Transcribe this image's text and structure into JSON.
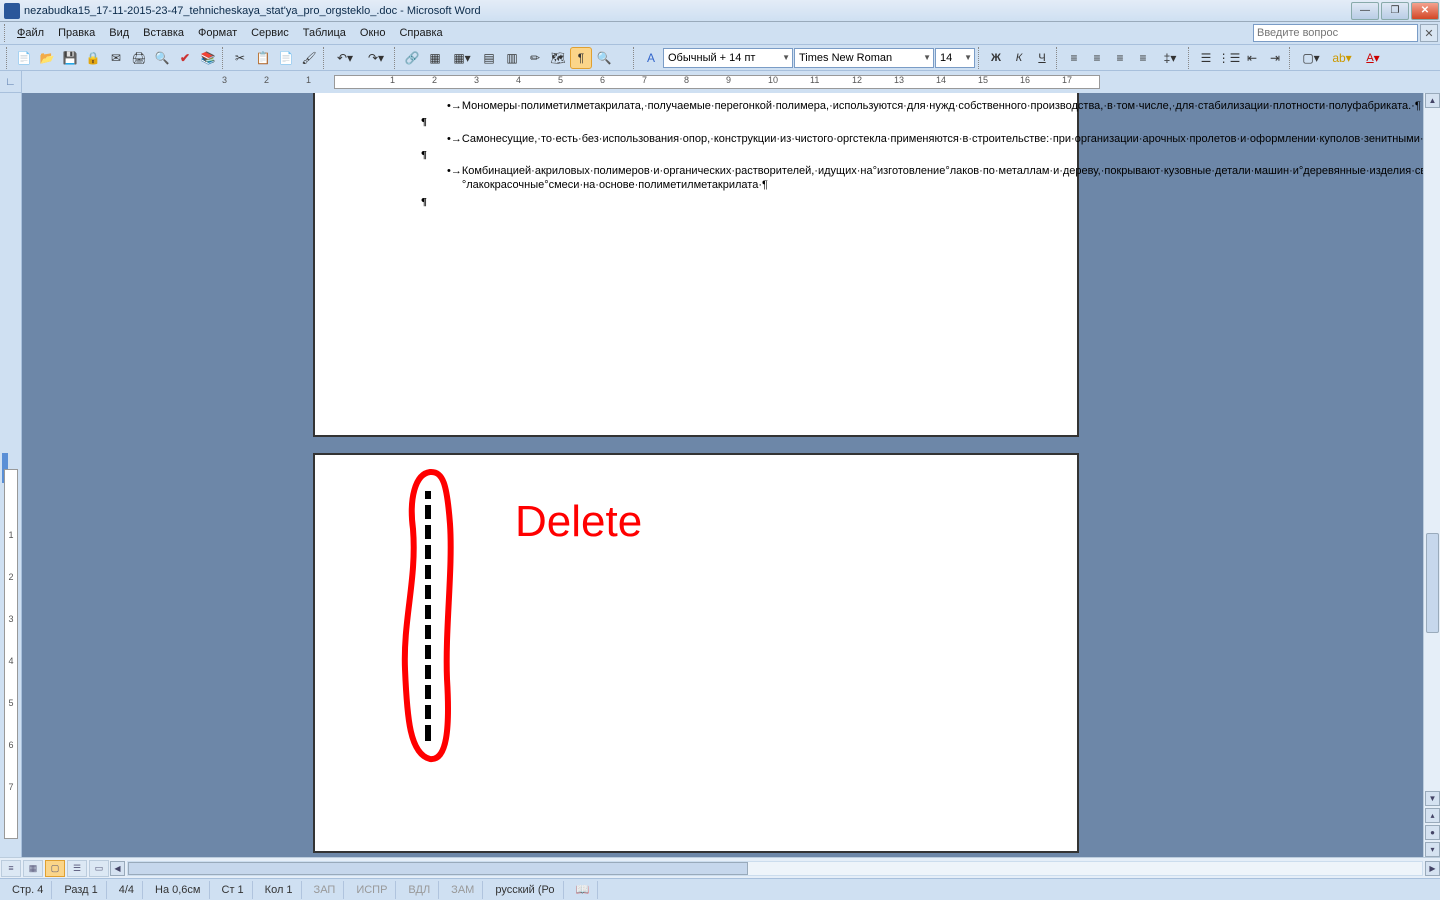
{
  "title": "nezabudka15_17-11-2015-23-47_tehnicheskaya_stat'ya_pro_orgsteklo_.doc - Microsoft Word",
  "menu": {
    "file": "Файл",
    "edit": "Правка",
    "view": "Вид",
    "insert": "Вставка",
    "format": "Формат",
    "service": "Сервис",
    "table": "Таблица",
    "window": "Окно",
    "help": "Справка"
  },
  "question_ph": "Введите вопрос",
  "style": "Обычный + 14 пт",
  "font": "Times New Roman",
  "size": "14",
  "ruler_h": [
    "3",
    "2",
    "1",
    "",
    "1",
    "2",
    "3",
    "4",
    "5",
    "6",
    "7",
    "8",
    "9",
    "10",
    "11",
    "12",
    "13",
    "14",
    "15",
    "16",
    "17"
  ],
  "ruler_v": [
    "",
    "1",
    "2",
    "3",
    "4",
    "5",
    "6",
    "7"
  ],
  "doc": {
    "li1": "Мономеры·полиметилметакрилата,·получаемые·перегонкой·полимера,·используются·для·нужд·собственного·производства,·в·том·числе,·для·стабилизации·плотности·полуфабриката.·¶",
    "li2": "Самонесущие,·то·есть·без·использования·опор,·конструкции·из·чистого·оргстекла·применяются·в·строительстве:·при·организации·арочных·пролетов·и·оформлении·куполов·зенитными·фонарями.·¶",
    "li3": "Комбинацией·акриловых·полимеров·и·органических·растворителей,·идущих·на°изготовление°лаков·по·металлам·и·дереву,·покрывают·кузовные·детали·машин·и°деревянные·изделия·светлых·тонов.·Кроме·того,°лакокрасочные°смеси·на·основе·полиметилметакрилата·¶",
    "pil": "¶"
  },
  "annot": {
    "label": "Delete"
  },
  "status": {
    "page": "Стр. 4",
    "sect": "Разд 1",
    "pages": "4/4",
    "at": "На 0,6см",
    "line": "Ст 1",
    "col": "Кол 1",
    "rec": "ЗАП",
    "trk": "ИСПР",
    "ext": "ВДЛ",
    "ovr": "ЗАМ",
    "lang": "русский (Ро"
  }
}
